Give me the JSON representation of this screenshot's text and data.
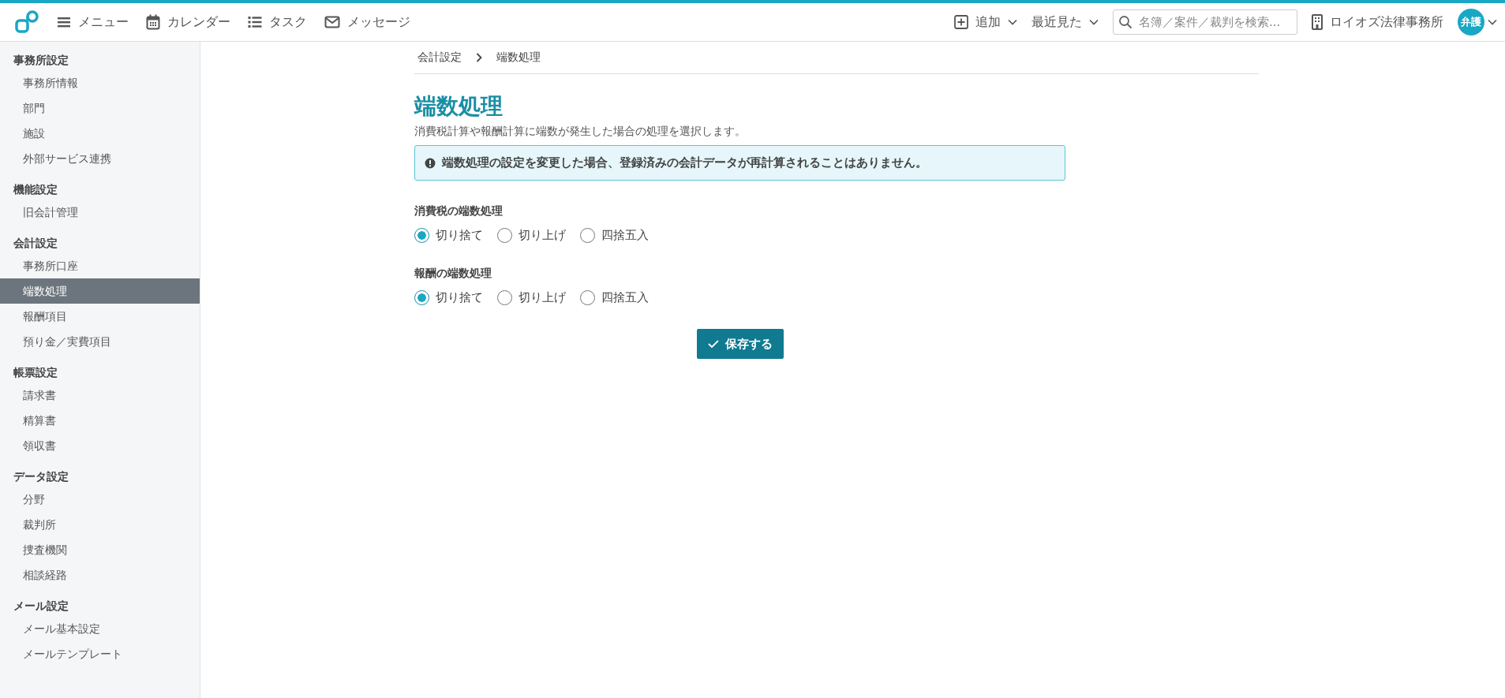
{
  "header": {
    "nav": [
      {
        "kind": "menu",
        "label": "メニュー"
      },
      {
        "kind": "calendar",
        "label": "カレンダー"
      },
      {
        "kind": "list",
        "label": "タスク"
      },
      {
        "kind": "mail",
        "label": "メッセージ"
      }
    ],
    "add": {
      "label": "追加"
    },
    "recent": {
      "label": "最近見た"
    },
    "search": {
      "placeholder": "名簿／案件／裁判を検索..."
    },
    "office": "ロイオズ法律事務所",
    "avatar": "弁護"
  },
  "sidebar": {
    "sections": [
      {
        "title": "事務所設定",
        "items": [
          {
            "label": "事務所情報",
            "selected": false
          },
          {
            "label": "部門",
            "selected": false
          },
          {
            "label": "施設",
            "selected": false
          },
          {
            "label": "外部サービス連携",
            "selected": false
          }
        ]
      },
      {
        "title": "機能設定",
        "items": [
          {
            "label": "旧会計管理",
            "selected": false
          }
        ]
      },
      {
        "title": "会計設定",
        "items": [
          {
            "label": "事務所口座",
            "selected": false
          },
          {
            "label": "端数処理",
            "selected": true
          },
          {
            "label": "報酬項目",
            "selected": false
          },
          {
            "label": "預り金／実費項目",
            "selected": false
          }
        ]
      },
      {
        "title": "帳票設定",
        "items": [
          {
            "label": "請求書",
            "selected": false
          },
          {
            "label": "精算書",
            "selected": false
          },
          {
            "label": "領収書",
            "selected": false
          }
        ]
      },
      {
        "title": "データ設定",
        "items": [
          {
            "label": "分野",
            "selected": false
          },
          {
            "label": "裁判所",
            "selected": false
          },
          {
            "label": "捜査機関",
            "selected": false
          },
          {
            "label": "相談経路",
            "selected": false
          }
        ]
      },
      {
        "title": "メール設定",
        "items": [
          {
            "label": "メール基本設定",
            "selected": false
          },
          {
            "label": "メールテンプレート",
            "selected": false
          }
        ]
      }
    ]
  },
  "breadcrumb": [
    "会計設定",
    "端数処理"
  ],
  "title": "端数処理",
  "description": "消費税計算や報酬計算に端数が発生した場合の処理を選択します。",
  "alert": "端数処理の設定を変更した場合、登録済みの会計データが再計算されることはありません。",
  "groups": [
    {
      "label": "消費税の端数処理",
      "options": [
        {
          "label": "切り捨て",
          "selected": true
        },
        {
          "label": "切り上げ",
          "selected": false
        },
        {
          "label": "四捨五入",
          "selected": false
        }
      ]
    },
    {
      "label": "報酬の端数処理",
      "options": [
        {
          "label": "切り捨て",
          "selected": true
        },
        {
          "label": "切り上げ",
          "selected": false
        },
        {
          "label": "四捨五入",
          "selected": false
        }
      ]
    }
  ],
  "save_button": "保存する"
}
